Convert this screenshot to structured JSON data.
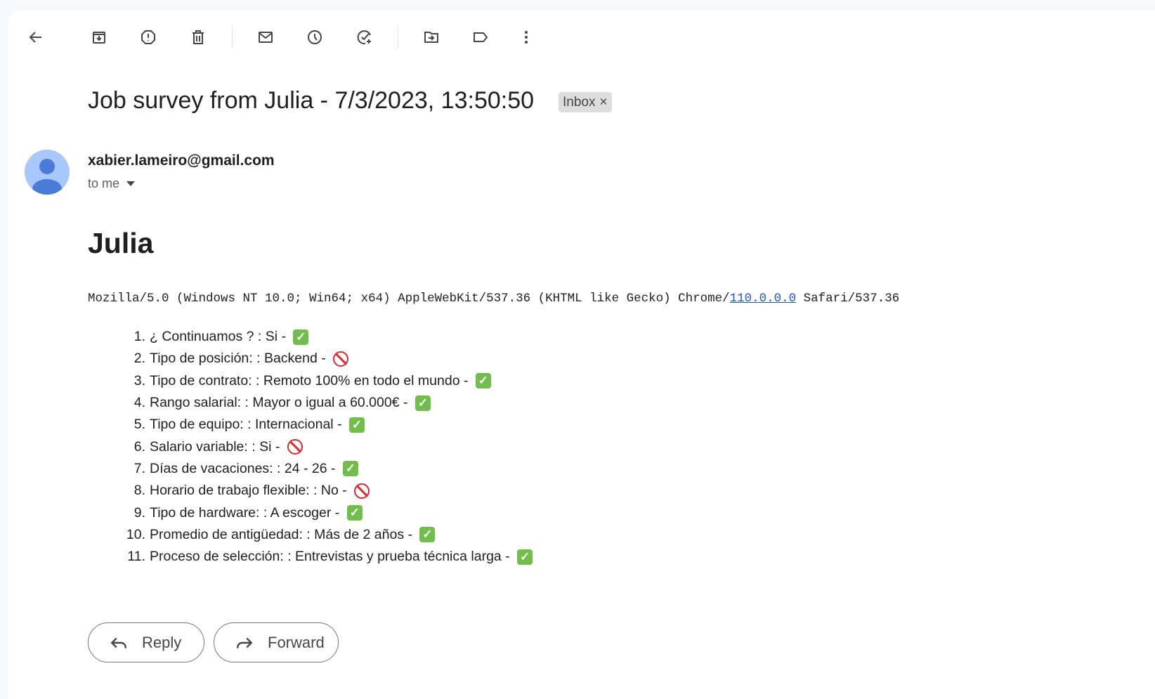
{
  "toolbar": {
    "icons": [
      "back-icon",
      "archive-icon",
      "report-spam-icon",
      "delete-icon",
      "mark-unread-icon",
      "snooze-icon",
      "add-task-icon",
      "move-to-icon",
      "label-icon",
      "more-icon"
    ]
  },
  "email": {
    "subject": "Job survey from Julia - 7/3/2023, 13:50:50",
    "label_chip": "Inbox",
    "label_close": "×",
    "sender": "xabier.lameiro@gmail.com",
    "recipient": "to me",
    "body_heading": "Julia",
    "user_agent_prefix": "Mozilla/5.0 (Windows NT 10.0; Win64; x64) AppleWebKit/537.36 (KHTML like Gecko) Chrome/",
    "user_agent_link": "110.0.0.0",
    "user_agent_suffix": " Safari/537.36",
    "items": [
      {
        "num": "1.",
        "text": "¿ Continuamos ? : Si - ",
        "status": "check"
      },
      {
        "num": "2.",
        "text": "Tipo de posición: : Backend - ",
        "status": "prohibited"
      },
      {
        "num": "3.",
        "text": "Tipo de contrato: : Remoto 100% en todo el mundo - ",
        "status": "check"
      },
      {
        "num": "4.",
        "text": "Rango salarial: : Mayor o igual a 60.000€ - ",
        "status": "check"
      },
      {
        "num": "5.",
        "text": "Tipo de equipo: : Internacional - ",
        "status": "check"
      },
      {
        "num": "6.",
        "text": "Salario variable: : Si - ",
        "status": "prohibited"
      },
      {
        "num": "7.",
        "text": "Días de vacaciones: : 24 - 26 - ",
        "status": "check"
      },
      {
        "num": "8.",
        "text": "Horario de trabajo flexible: : No - ",
        "status": "prohibited"
      },
      {
        "num": "9.",
        "text": "Tipo de hardware: : A escoger - ",
        "status": "check"
      },
      {
        "num": "10.",
        "text": "Promedio de antigüedad: : Más de 2 años - ",
        "status": "check"
      },
      {
        "num": "11.",
        "text": "Proceso de selección: : Entrevistas y prueba técnica larga - ",
        "status": "check"
      }
    ]
  },
  "actions": {
    "reply": "Reply",
    "forward": "Forward"
  },
  "colors": {
    "check": "#6fbf4a",
    "prohibited": "#e0282e",
    "link": "#1a56d6",
    "avatar": "#a8c7fa"
  }
}
